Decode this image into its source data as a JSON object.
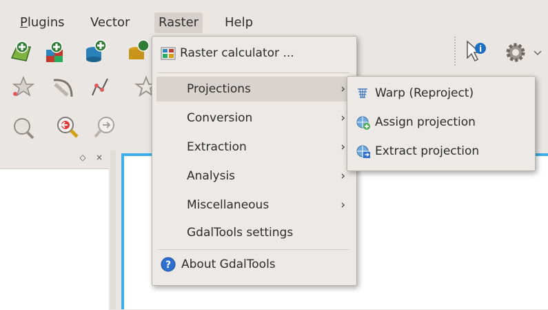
{
  "menubar": {
    "items": [
      {
        "label": "Plugins"
      },
      {
        "label": "Vector"
      },
      {
        "label": "Raster"
      },
      {
        "label": "Help"
      }
    ]
  },
  "raster_menu": {
    "items": [
      {
        "label": "Raster calculator ...",
        "icon": "raster-calculator-icon"
      },
      {
        "label": "Projections",
        "submenu": true
      },
      {
        "label": "Conversion",
        "submenu": true
      },
      {
        "label": "Extraction",
        "submenu": true
      },
      {
        "label": "Analysis",
        "submenu": true
      },
      {
        "label": "Miscellaneous",
        "submenu": true
      },
      {
        "label": "GdalTools settings"
      },
      {
        "label": "About GdalTools",
        "icon": "help-icon"
      }
    ]
  },
  "projections_submenu": {
    "items": [
      {
        "label": "Warp (Reproject)",
        "icon": "warp-icon"
      },
      {
        "label": "Assign projection",
        "icon": "assign-projection-icon"
      },
      {
        "label": "Extract projection",
        "icon": "extract-projection-icon"
      }
    ]
  },
  "colors": {
    "accent": "#3daee9",
    "highlight": "#d8d3cf",
    "menu_bg": "#ece9e6"
  },
  "dock": {
    "float_glyph": "◇",
    "close_glyph": "×"
  },
  "arrow_glyph": "›"
}
